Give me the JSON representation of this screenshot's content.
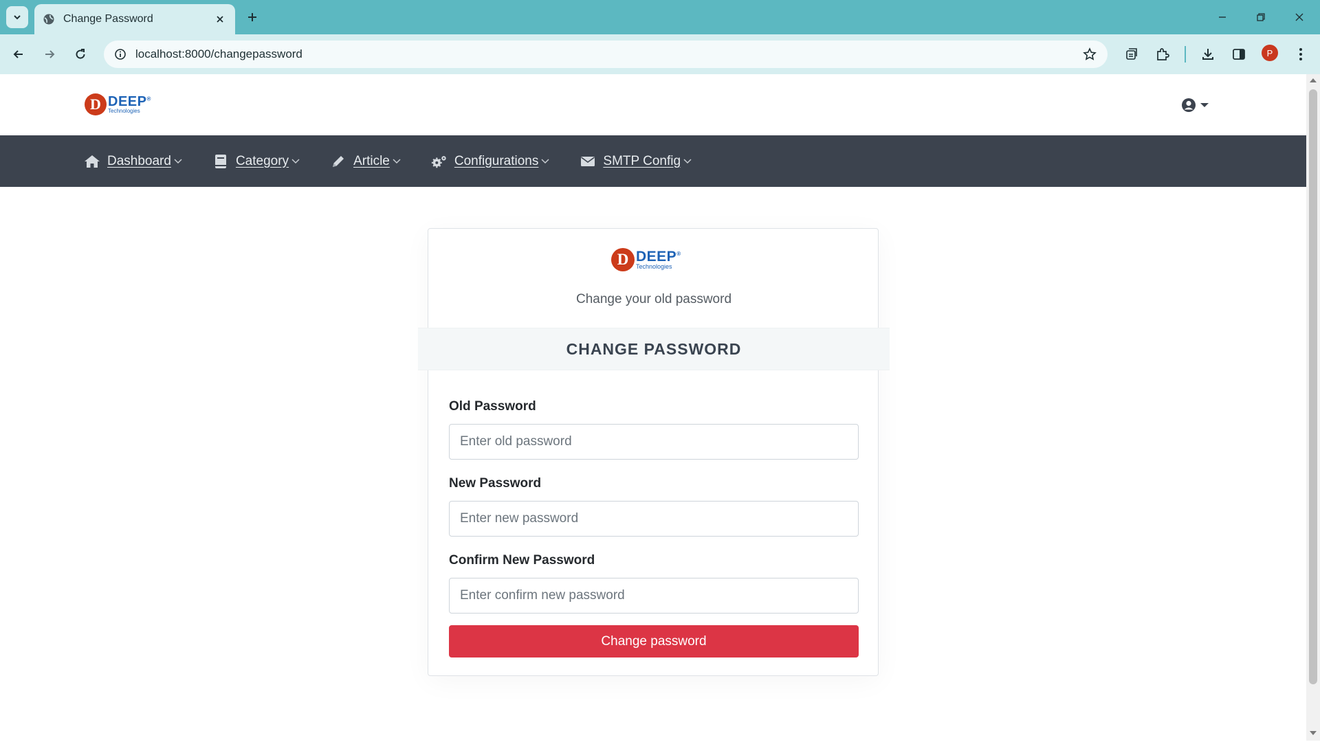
{
  "browser": {
    "tab_title": "Change Password",
    "url": "localhost:8000/changepassword",
    "profile_initial": "P"
  },
  "header": {
    "logo": {
      "letter": "D",
      "word": "DEEP",
      "sub": "Technologies",
      "reg": "®"
    },
    "user_icon": "user-circle-icon"
  },
  "nav": {
    "items": [
      {
        "label": "Dashboard",
        "icon": "home-icon"
      },
      {
        "label": "Category",
        "icon": "book-icon"
      },
      {
        "label": "Article",
        "icon": "pencil-icon"
      },
      {
        "label": "Configurations",
        "icon": "gears-icon"
      },
      {
        "label": "SMTP Config",
        "icon": "envelope-icon"
      }
    ]
  },
  "card": {
    "subtitle": "Change your old password",
    "heading": "CHANGE PASSWORD",
    "fields": [
      {
        "label": "Old Password",
        "placeholder": "Enter old password"
      },
      {
        "label": "New Password",
        "placeholder": "Enter new password"
      },
      {
        "label": "Confirm New Password",
        "placeholder": "Enter confirm new password"
      }
    ],
    "submit_label": "Change password"
  },
  "colors": {
    "chrome": "#5cb8c1",
    "navbar": "#3c434e",
    "submit": "#dc3545",
    "logo_red": "#cc3b1a",
    "logo_blue": "#1e63b6"
  }
}
